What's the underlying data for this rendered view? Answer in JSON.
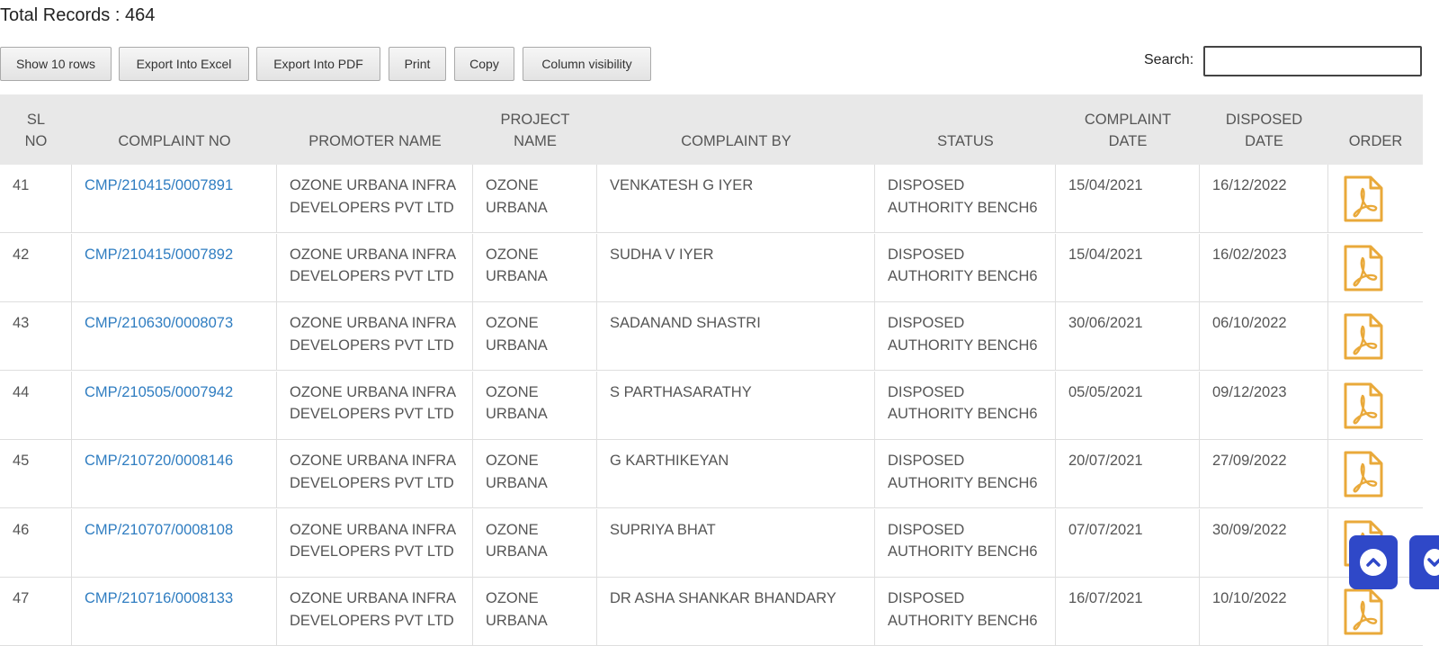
{
  "header": {
    "total_records": "Total Records : 464"
  },
  "toolbar": {
    "buttons": [
      "Show 10 rows",
      "Export Into Excel",
      "Export Into PDF",
      "Print",
      "Copy",
      "Column visibility"
    ],
    "search_label": "Search:",
    "search_value": ""
  },
  "table": {
    "columns": [
      [
        "SL",
        "NO"
      ],
      [
        "COMPLAINT NO"
      ],
      [
        "PROMOTER NAME"
      ],
      [
        "PROJECT",
        "NAME"
      ],
      [
        "COMPLAINT BY"
      ],
      [
        "STATUS"
      ],
      [
        "COMPLAINT",
        "DATE"
      ],
      [
        "DISPOSED",
        "DATE"
      ],
      [
        "ORDER"
      ]
    ],
    "rows": [
      {
        "sl": "41",
        "complaint_no": "CMP/210415/0007891",
        "promoter": [
          "OZONE URBANA INFRA",
          "DEVELOPERS PVT LTD"
        ],
        "project": [
          "OZONE",
          "URBANA"
        ],
        "complaint_by": "VENKATESH G IYER",
        "status": [
          "DISPOSED",
          "AUTHORITY BENCH6"
        ],
        "complaint_date": "15/04/2021",
        "disposed_date": "16/12/2022",
        "order_icon": "pdf-file-icon"
      },
      {
        "sl": "42",
        "complaint_no": "CMP/210415/0007892",
        "promoter": [
          "OZONE URBANA INFRA",
          "DEVELOPERS PVT LTD"
        ],
        "project": [
          "OZONE",
          "URBANA"
        ],
        "complaint_by": "SUDHA V IYER",
        "status": [
          "DISPOSED",
          "AUTHORITY BENCH6"
        ],
        "complaint_date": "15/04/2021",
        "disposed_date": "16/02/2023",
        "order_icon": "pdf-file-icon"
      },
      {
        "sl": "43",
        "complaint_no": "CMP/210630/0008073",
        "promoter": [
          "OZONE URBANA INFRA",
          "DEVELOPERS PVT LTD"
        ],
        "project": [
          "OZONE",
          "URBANA"
        ],
        "complaint_by": "SADANAND SHASTRI",
        "status": [
          "DISPOSED",
          "AUTHORITY BENCH6"
        ],
        "complaint_date": "30/06/2021",
        "disposed_date": "06/10/2022",
        "order_icon": "pdf-file-icon"
      },
      {
        "sl": "44",
        "complaint_no": "CMP/210505/0007942",
        "promoter": [
          "OZONE URBANA INFRA",
          "DEVELOPERS PVT LTD"
        ],
        "project": [
          "OZONE",
          "URBANA"
        ],
        "complaint_by": "S PARTHASARATHY",
        "status": [
          "DISPOSED",
          "AUTHORITY BENCH6"
        ],
        "complaint_date": "05/05/2021",
        "disposed_date": "09/12/2023",
        "order_icon": "pdf-file-icon"
      },
      {
        "sl": "45",
        "complaint_no": "CMP/210720/0008146",
        "promoter": [
          "OZONE URBANA INFRA",
          "DEVELOPERS PVT LTD"
        ],
        "project": [
          "OZONE",
          "URBANA"
        ],
        "complaint_by": "G KARTHIKEYAN",
        "status": [
          "DISPOSED",
          "AUTHORITY BENCH6"
        ],
        "complaint_date": "20/07/2021",
        "disposed_date": "27/09/2022",
        "order_icon": "pdf-file-icon"
      },
      {
        "sl": "46",
        "complaint_no": "CMP/210707/0008108",
        "promoter": [
          "OZONE URBANA INFRA",
          "DEVELOPERS PVT LTD"
        ],
        "project": [
          "OZONE",
          "URBANA"
        ],
        "complaint_by": "SUPRIYA BHAT",
        "status": [
          "DISPOSED",
          "AUTHORITY BENCH6"
        ],
        "complaint_date": "07/07/2021",
        "disposed_date": "30/09/2022",
        "order_icon": "pdf-file-icon"
      },
      {
        "sl": "47",
        "complaint_no": "CMP/210716/0008133",
        "promoter": [
          "OZONE URBANA INFRA",
          "DEVELOPERS PVT LTD"
        ],
        "project": [
          "OZONE",
          "URBANA"
        ],
        "complaint_by": "DR ASHA SHANKAR BHANDARY",
        "status": [
          "DISPOSED",
          "AUTHORITY BENCH6"
        ],
        "complaint_date": "16/07/2021",
        "disposed_date": "10/10/2022",
        "order_icon": "pdf-file-icon"
      }
    ]
  },
  "floating": {
    "up_icon": "chevron-up-icon",
    "down_icon": "chevron-down-icon",
    "color": "#2f48c8"
  },
  "colors": {
    "link": "#2f7dc1",
    "pdf_icon": "#e9a93a",
    "header_bg": "#e8e8e8"
  }
}
